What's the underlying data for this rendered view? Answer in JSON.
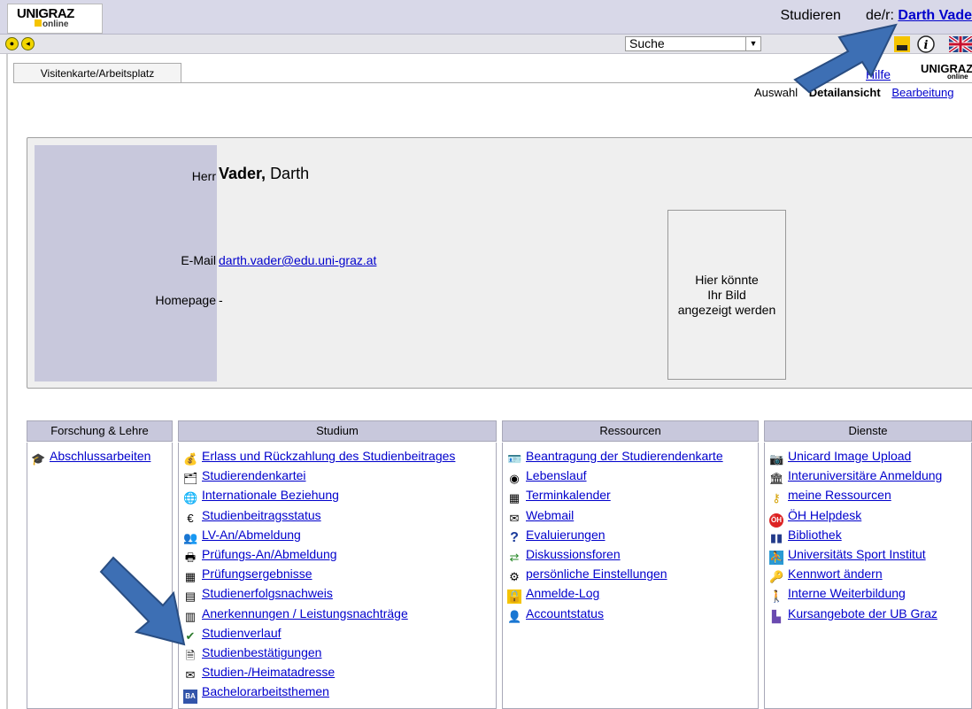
{
  "header": {
    "logo_text": "UNIGRAZ",
    "logo_sub": "online",
    "user_prefix": "Studieren",
    "user_mid": "de/r:",
    "user_name": "Darth Vade"
  },
  "toolbar": {
    "search_value": "Suche",
    "icons": [
      "uni-icon",
      "info-icon",
      "uk-flag-icon"
    ]
  },
  "tabs": {
    "active": "Visitenkarte/Arbeitsplatz"
  },
  "top_right": {
    "hilfe": "Hilfe",
    "logo": "UNIGRAZ",
    "logo_sub": "online",
    "views": [
      "Auswahl",
      "Detailansicht",
      "Bearbeitung"
    ]
  },
  "person": {
    "salutation": "Herr",
    "last_name": "Vader,",
    "first_name": "Darth",
    "email_label": "E-Mail",
    "email": "darth.vader@edu.uni-graz.at",
    "homepage_label": "Homepage",
    "homepage": "-",
    "photo_text_1": "Hier könnte",
    "photo_text_2": "Ihr Bild",
    "photo_text_3": "angezeigt werden"
  },
  "columns": [
    {
      "title": "Forschung & Lehre",
      "items": [
        {
          "label": "Abschlussarbeiten",
          "icon": "graduation-cap-icon"
        }
      ]
    },
    {
      "title": "Studium",
      "items": [
        {
          "label": "Erlass und Rückzahlung des Studienbeitrages",
          "icon": "money-icon"
        },
        {
          "label": "Studierendenkartei",
          "icon": "card-index-icon"
        },
        {
          "label": "Internationale Beziehung",
          "icon": "globe-icon"
        },
        {
          "label": "Studienbeitragsstatus",
          "icon": "euro-icon"
        },
        {
          "label": "LV-An/Abmeldung",
          "icon": "people-icon"
        },
        {
          "label": "Prüfungs-An/Abmeldung",
          "icon": "exam-icon"
        },
        {
          "label": "Prüfungsergebnisse",
          "icon": "results-icon"
        },
        {
          "label": "Studienerfolgsnachweis",
          "icon": "certificate-icon"
        },
        {
          "label": "Anerkennungen / Leistungsnachträge",
          "icon": "recognition-icon"
        },
        {
          "label": "Studienverlauf",
          "icon": "progress-icon"
        },
        {
          "label": "Studienbestätigungen",
          "icon": "document-icon"
        },
        {
          "label": "Studien-/Heimatadresse",
          "icon": "envelope-icon"
        },
        {
          "label": "Bachelorarbeitsthemen",
          "icon": "ba-icon"
        }
      ]
    },
    {
      "title": "Ressourcen",
      "items": [
        {
          "label": "Beantragung der Studierendenkarte",
          "icon": "id-card-icon"
        },
        {
          "label": "Lebenslauf",
          "icon": "cv-icon"
        },
        {
          "label": "Terminkalender",
          "icon": "calendar-icon"
        },
        {
          "label": "Webmail",
          "icon": "mail-icon"
        },
        {
          "label": "Evaluierungen",
          "icon": "question-icon"
        },
        {
          "label": "Diskussionsforen",
          "icon": "forum-icon"
        },
        {
          "label": "persönliche Einstellungen",
          "icon": "settings-icon"
        },
        {
          "label": "Anmelde-Log",
          "icon": "lock-icon"
        },
        {
          "label": "Accountstatus",
          "icon": "account-icon"
        }
      ]
    },
    {
      "title": "Dienste",
      "items": [
        {
          "label": "Unicard Image Upload",
          "icon": "camera-icon"
        },
        {
          "label": "Interuniversitäre Anmeldung",
          "icon": "building-icon"
        },
        {
          "label": "meine Ressourcen",
          "icon": "key-icon"
        },
        {
          "label": "ÖH Helpdesk",
          "icon": "oh-icon"
        },
        {
          "label": "Bibliothek",
          "icon": "library-icon"
        },
        {
          "label": "Universitäts Sport Institut",
          "icon": "sport-icon"
        },
        {
          "label": "Kennwort ändern",
          "icon": "password-icon"
        },
        {
          "label": "Interne Weiterbildung",
          "icon": "training-icon"
        },
        {
          "label": "Kursangebote der UB Graz",
          "icon": "courses-icon"
        }
      ]
    }
  ],
  "colors": {
    "header_bg": "#d8d8e8",
    "column_header_bg": "#c8c8dc",
    "link": "#0000cc",
    "arrow": "#3d6fb4"
  }
}
